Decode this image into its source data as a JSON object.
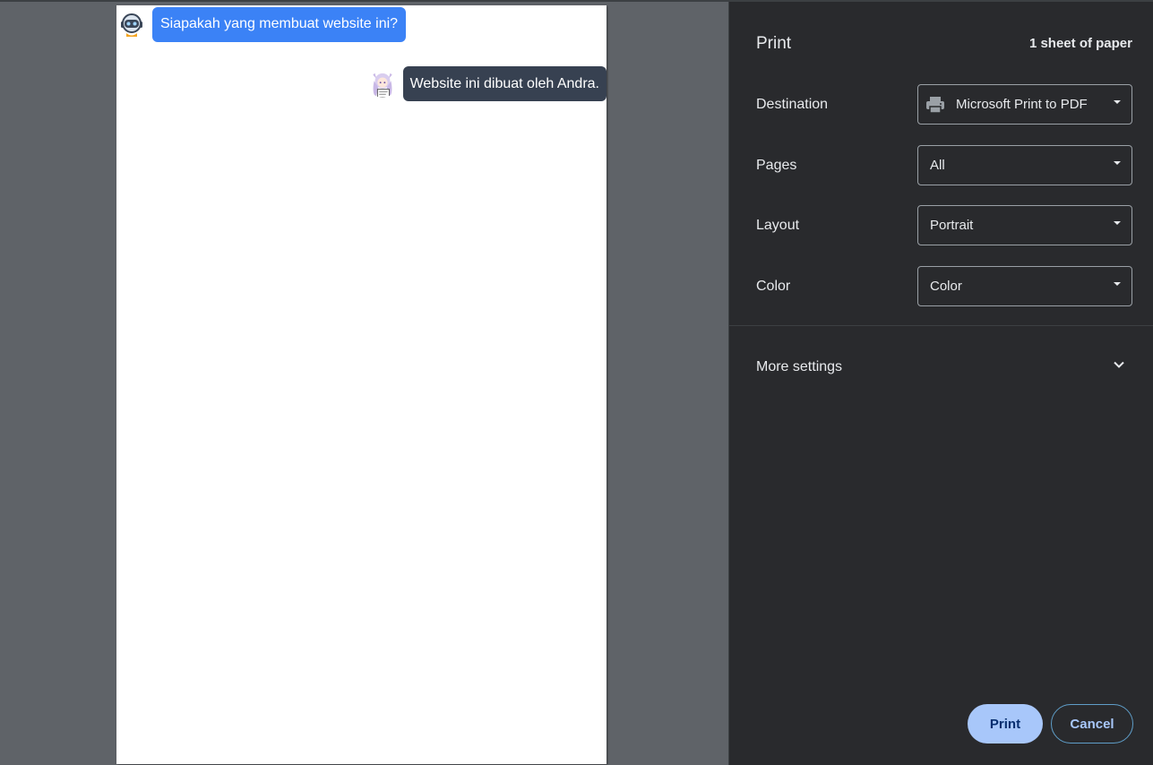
{
  "preview": {
    "messages": [
      {
        "sender": "bot",
        "text": "Siapakah yang membuat website ini?"
      },
      {
        "sender": "user",
        "text": "Website ini dibuat oleh Andra."
      }
    ],
    "colors": {
      "question_bubble": "#3b82f6",
      "answer_bubble": "#374151"
    }
  },
  "panel": {
    "title": "Print",
    "sheet_count": "1 sheet of paper",
    "destination": {
      "label": "Destination",
      "value": "Microsoft Print to PDF",
      "icon": "printer-icon"
    },
    "pages": {
      "label": "Pages",
      "value": "All"
    },
    "layout": {
      "label": "Layout",
      "value": "Portrait"
    },
    "color": {
      "label": "Color",
      "value": "Color"
    },
    "more_settings": {
      "label": "More settings",
      "icon": "chevron-down-icon"
    },
    "print_button": "Print",
    "cancel_button": "Cancel",
    "colors": {
      "panel_bg": "#292a2d",
      "primary_button": "#a8c7fa"
    }
  }
}
